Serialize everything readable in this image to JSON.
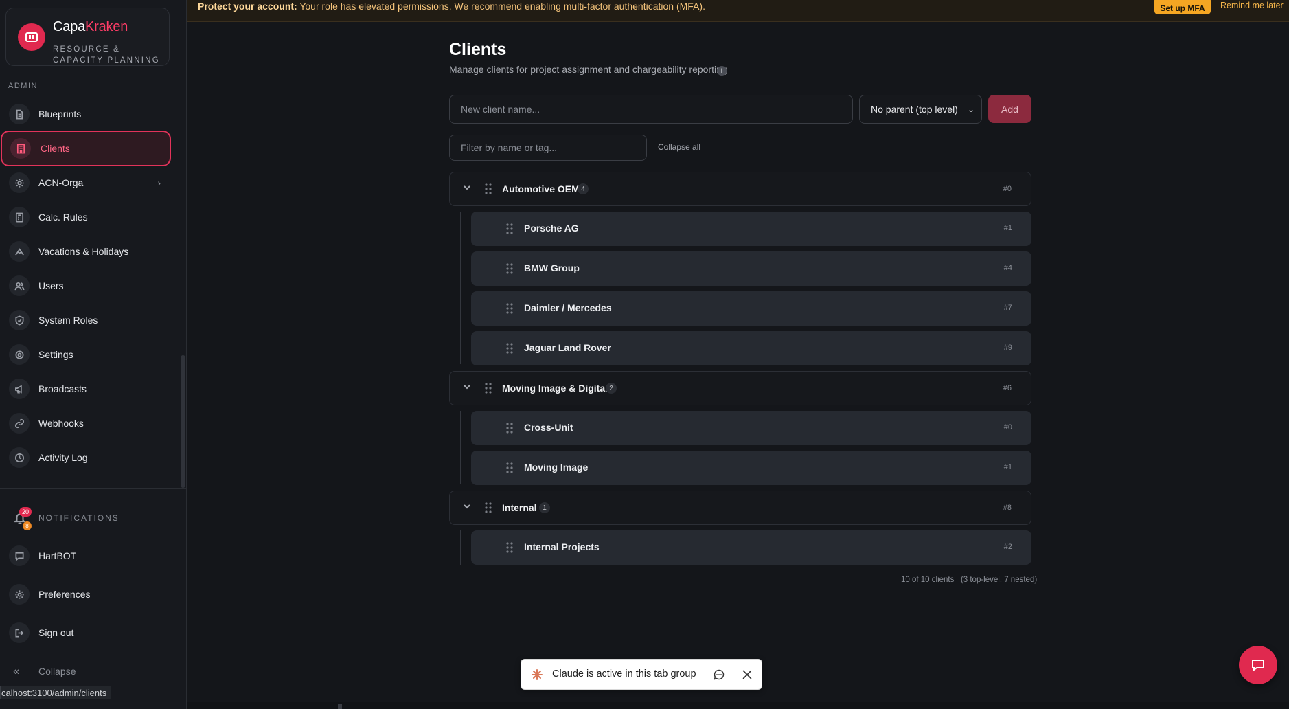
{
  "brand": {
    "name_part1": "Capa",
    "name_part2": "Kraken",
    "tagline": "RESOURCE & CAPACITY PLANNING"
  },
  "sidebar": {
    "section_label": "ADMIN",
    "items": [
      {
        "label": "Blueprints",
        "icon": "document-icon"
      },
      {
        "label": "Clients",
        "icon": "building-icon",
        "active": true
      },
      {
        "label": "ACN-Orga",
        "icon": "gear-icon",
        "has_chevron": true
      },
      {
        "label": "Calc. Rules",
        "icon": "calculator-icon"
      },
      {
        "label": "Vacations & Holidays",
        "icon": "mountain-icon"
      },
      {
        "label": "Users",
        "icon": "users-icon"
      },
      {
        "label": "System Roles",
        "icon": "shield-icon"
      },
      {
        "label": "Settings",
        "icon": "cog-icon"
      },
      {
        "label": "Broadcasts",
        "icon": "megaphone-icon"
      },
      {
        "label": "Webhooks",
        "icon": "link-icon"
      },
      {
        "label": "Activity Log",
        "icon": "clock-icon"
      }
    ],
    "notifications": {
      "label": "NOTIFICATIONS",
      "count_primary": "20",
      "count_secondary": "8"
    },
    "bottom_items": [
      {
        "label": "HartBOT",
        "icon": "chat-icon"
      },
      {
        "label": "Preferences",
        "icon": "cog-icon"
      },
      {
        "label": "Sign out",
        "icon": "logout-icon"
      }
    ],
    "collapse_label": "Collapse"
  },
  "banner": {
    "bold": "Protect your account:",
    "text": " Your role has elevated permissions. We recommend enabling multi-factor authentication (MFA).",
    "mfa_button": "Set up MFA",
    "remind": "Remind me later"
  },
  "page": {
    "title": "Clients",
    "subtitle": "Manage clients for project assignment and chargeability reporting",
    "new_client_placeholder": "New client name...",
    "parent_select": "No parent (top level)",
    "add_button": "Add",
    "filter_placeholder": "Filter by name or tag...",
    "collapse_all": "Collapse all",
    "footer_count": "10 of 10 clients   (3 top-level, 7 nested)"
  },
  "groups": [
    {
      "name": "Automotive OEM",
      "count": "4",
      "index": "#0",
      "children": [
        {
          "name": "Porsche AG",
          "index": "#1"
        },
        {
          "name": "BMW Group",
          "index": "#4"
        },
        {
          "name": "Daimler / Mercedes",
          "index": "#7"
        },
        {
          "name": "Jaguar Land Rover",
          "index": "#9"
        }
      ]
    },
    {
      "name": "Moving Image & Digital",
      "count": "2",
      "index": "#6",
      "children": [
        {
          "name": "Cross-Unit",
          "index": "#0"
        },
        {
          "name": "Moving Image",
          "index": "#1"
        }
      ]
    },
    {
      "name": "Internal",
      "count": "1",
      "index": "#8",
      "children": [
        {
          "name": "Internal Projects",
          "index": "#2"
        }
      ]
    }
  ],
  "status_url": "calhost:3100/admin/clients",
  "toast": {
    "label": "Claude is active in this tab group"
  },
  "colors": {
    "accent": "#e0294f",
    "banner_button": "#f5a623"
  }
}
